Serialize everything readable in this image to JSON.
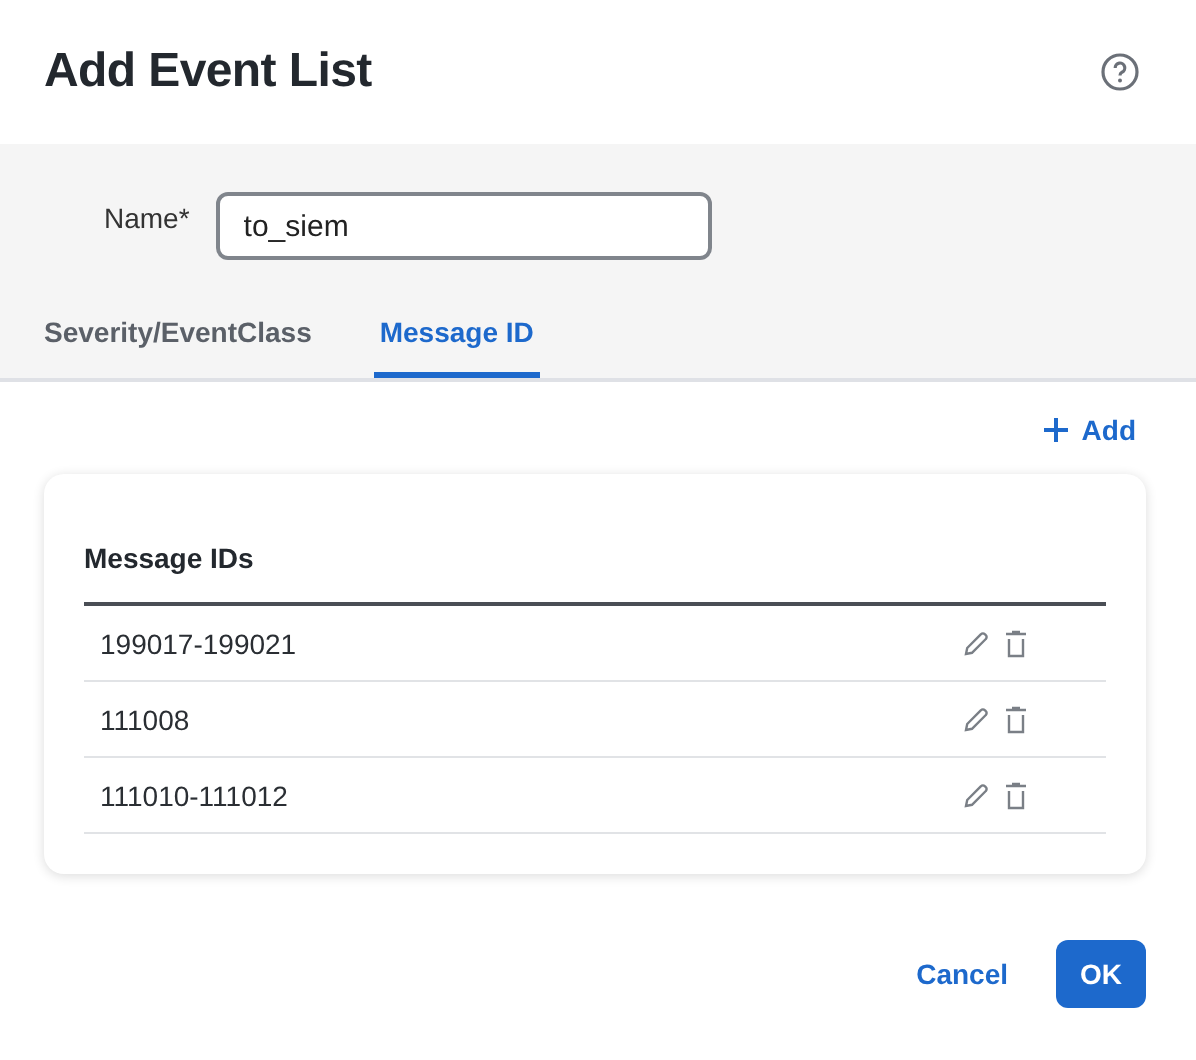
{
  "dialog": {
    "title": "Add Event List"
  },
  "name_field": {
    "label": "Name*",
    "value": "to_siem"
  },
  "tabs": [
    {
      "label": "Severity/EventClass",
      "selected": false
    },
    {
      "label": "Message ID",
      "selected": true
    }
  ],
  "add_button": {
    "label": "Add"
  },
  "table": {
    "columns": [
      "Message IDs"
    ],
    "rows": [
      {
        "id": "199017-199021"
      },
      {
        "id": "111008"
      },
      {
        "id": "111010-111012"
      }
    ]
  },
  "buttons": [
    {
      "label": "Cancel",
      "kind": "secondary"
    },
    {
      "label": "OK",
      "kind": "primary"
    }
  ]
}
